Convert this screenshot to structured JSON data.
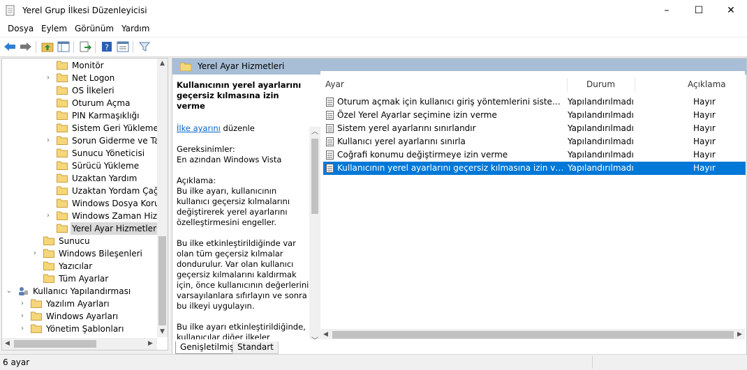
{
  "window": {
    "title": "Yerel Grup İlkesi Düzenleyicisi",
    "minimize": "–",
    "maximize": "☐",
    "close": "✕"
  },
  "menu": [
    "Dosya",
    "Eylem",
    "Görünüm",
    "Yardım"
  ],
  "tree": {
    "items": [
      {
        "label": "Monitör",
        "chevron": ""
      },
      {
        "label": "Net Logon",
        "chevron": "›"
      },
      {
        "label": "OS İlkeleri",
        "chevron": ""
      },
      {
        "label": "Oturum Açma",
        "chevron": ""
      },
      {
        "label": "PIN Karmaşıklığı",
        "chevron": ""
      },
      {
        "label": "Sistem Geri Yükleme",
        "chevron": ""
      },
      {
        "label": "Sorun Giderme ve Tanı",
        "chevron": "›"
      },
      {
        "label": "Sunucu Yöneticisi",
        "chevron": ""
      },
      {
        "label": "Sürücü Yükleme",
        "chevron": ""
      },
      {
        "label": "Uzaktan Yardım",
        "chevron": ""
      },
      {
        "label": "Uzaktan Yordam Çağrısı",
        "chevron": ""
      },
      {
        "label": "Windows Dosya Koruma",
        "chevron": ""
      },
      {
        "label": "Windows Zaman Hizmeti",
        "chevron": "›"
      },
      {
        "label": "Yerel Ayar Hizmetleri",
        "chevron": ""
      },
      {
        "label": "Sunucu",
        "chevron": ""
      },
      {
        "label": "Windows Bileşenleri",
        "chevron": "›"
      },
      {
        "label": "Yazıcılar",
        "chevron": ""
      },
      {
        "label": "Tüm Ayarlar",
        "chevron": ""
      },
      {
        "label": "Kullanıcı Yapılandırması",
        "chevron": "⌄"
      },
      {
        "label": "Yazılım Ayarları",
        "chevron": "›"
      },
      {
        "label": "Windows Ayarları",
        "chevron": "›"
      },
      {
        "label": "Yönetim Şablonları",
        "chevron": "›"
      }
    ]
  },
  "panel": {
    "header": "Yerel Ayar Hizmetleri",
    "description": {
      "title": "Kullanıcının yerel ayarlarını geçersiz kılmasına izin verme",
      "edit_link": "İlke ayarını",
      "edit_suffix": " düzenle",
      "requirements_label": "Gereksinimler:",
      "requirements_value": "En azından Windows Vista",
      "desc_label": "Açıklama:",
      "para1": "Bu ilke ayarı, kullanıcının kullanıcı geçersiz kılmalarını değiştirerek yerel ayarlarını özelleştirmesini engeller.",
      "para2": "Bu ilke etkinleştirildiğinde var olan tüm geçersiz kılmalar dondurulur. Var olan kullanıcı geçersiz kılmalarını kaldırmak için, önce kullanıcının değerlerini varsayılanlara sıfırlayın ve sonra bu ilkeyi uygulayın.",
      "para3": "Bu ilke ayarı etkinleştirildiğinde, kullanıcılar diğer ilkeler tarafından engellenmedikçe, sistemde yüklü"
    },
    "columns": {
      "setting": "Ayar",
      "state": "Durum",
      "comment": "Açıklama"
    },
    "rows": [
      {
        "setting": "Oturum açmak için kullanıcı giriş yöntemlerini sistem hesabına kopyalamaya izin verme",
        "state": "Yapılandırılmadı",
        "comment": "Hayır"
      },
      {
        "setting": "Özel Yerel Ayarlar seçimine izin verme",
        "state": "Yapılandırılmadı",
        "comment": "Hayır"
      },
      {
        "setting": "Sistem yerel ayarlarını sınırlandır",
        "state": "Yapılandırılmadı",
        "comment": "Hayır"
      },
      {
        "setting": "Kullanıcı yerel ayarlarını sınırla",
        "state": "Yapılandırılmadı",
        "comment": "Hayır"
      },
      {
        "setting": "Coğrafi konumu değiştirmeye izin verme",
        "state": "Yapılandırılmadı",
        "comment": "Hayır"
      },
      {
        "setting": "Kullanıcının yerel ayarlarını geçersiz kılmasına izin verme",
        "state": "Yapılandırılmadı",
        "comment": "Hayır"
      }
    ],
    "tabs": [
      "Genişletilmiş",
      "Standart"
    ]
  },
  "status": {
    "text": "6 ayar"
  },
  "colors": {
    "selection": "#0078d7",
    "header_band": "#a7bed6",
    "link": "#0066cc"
  }
}
